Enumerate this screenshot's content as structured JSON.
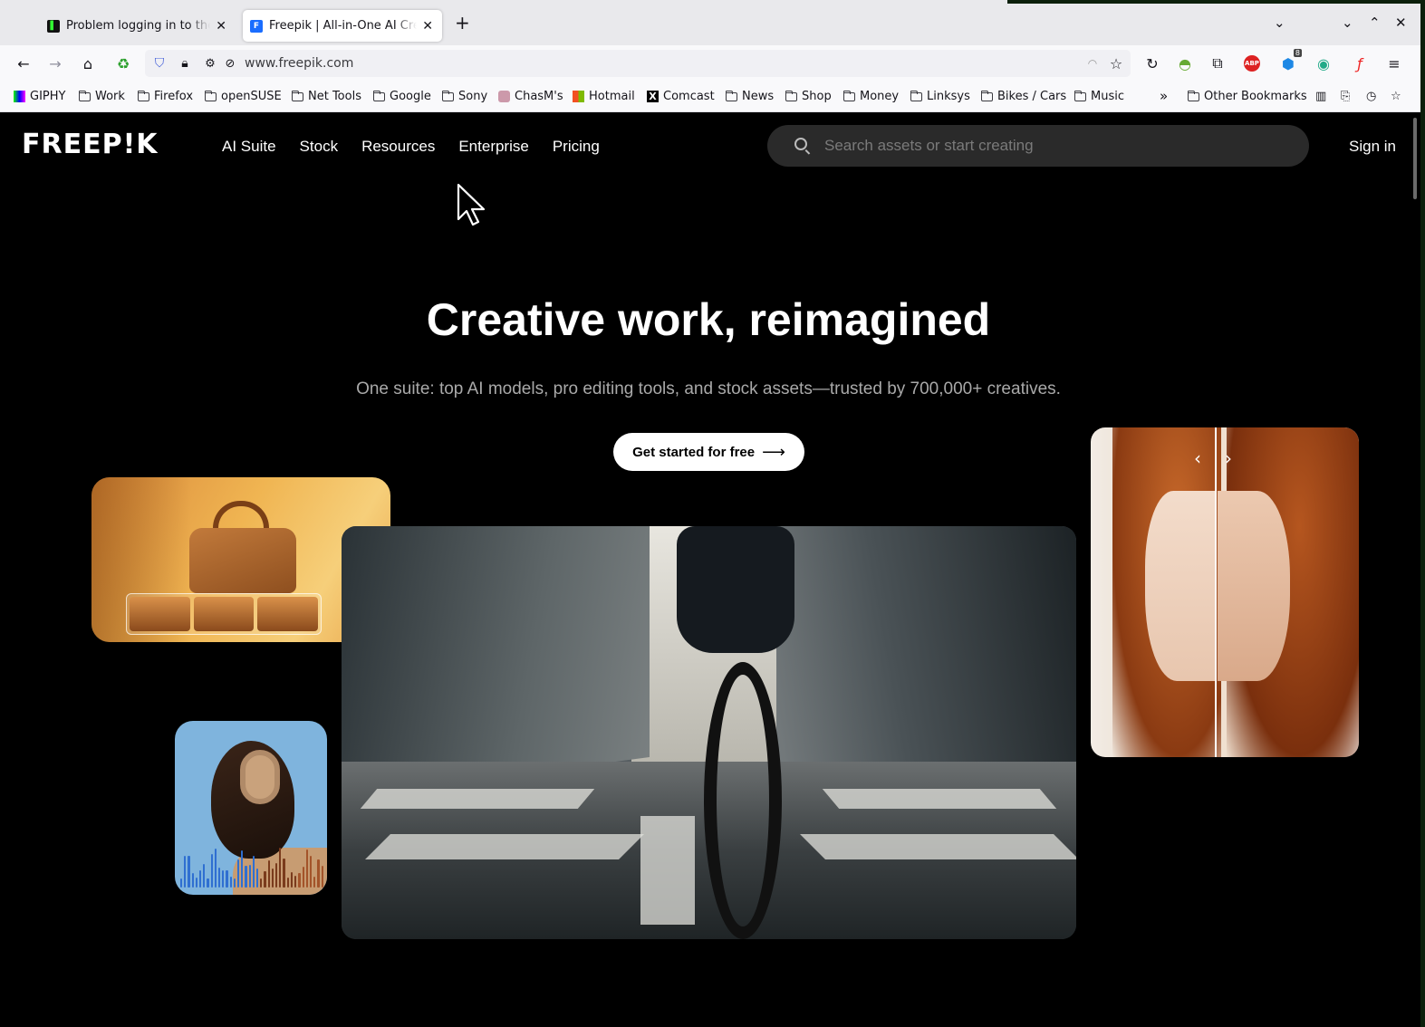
{
  "browser": {
    "tabs": [
      {
        "title": "Problem logging in to the s",
        "active": false
      },
      {
        "title": "Freepik | All-in-One AI Crea",
        "active": true
      }
    ],
    "new_tab_glyph": "+",
    "url": "www.freepik.com",
    "bookmarks": [
      {
        "label": "GIPHY",
        "icon": "giphy"
      },
      {
        "label": "Work",
        "icon": "folder"
      },
      {
        "label": "Firefox",
        "icon": "folder"
      },
      {
        "label": "openSUSE",
        "icon": "folder"
      },
      {
        "label": "Net Tools",
        "icon": "folder"
      },
      {
        "label": "Google",
        "icon": "folder"
      },
      {
        "label": "Sony",
        "icon": "folder"
      },
      {
        "label": "ChasM's",
        "icon": "site"
      },
      {
        "label": "Hotmail",
        "icon": "microsoft"
      },
      {
        "label": "Comcast",
        "icon": "x"
      },
      {
        "label": "News",
        "icon": "folder"
      },
      {
        "label": "Shop",
        "icon": "folder"
      },
      {
        "label": "Money",
        "icon": "folder"
      },
      {
        "label": "Linksys",
        "icon": "folder"
      },
      {
        "label": "Bikes / Cars",
        "icon": "folder"
      },
      {
        "label": "Music",
        "icon": "folder"
      }
    ],
    "other_bookmarks": "Other Bookmarks",
    "extension_badge": "8"
  },
  "site": {
    "logo": "FREEP!K",
    "nav": [
      "AI Suite",
      "Stock",
      "Resources",
      "Enterprise",
      "Pricing"
    ],
    "search_placeholder": "Search assets or start creating",
    "sign_in": "Sign in",
    "hero": {
      "headline": "Creative work, reimagined",
      "subheadline": "One suite: top AI models, pro editing tools, and stock assets—trusted by 700,000+ creatives.",
      "cta": "Get started for free",
      "cta_arrow": "⟶"
    },
    "colors": {
      "background": "#000000",
      "text": "#ffffff",
      "muted": "#a9a9a9",
      "search_bg": "#2a2a2a"
    }
  }
}
